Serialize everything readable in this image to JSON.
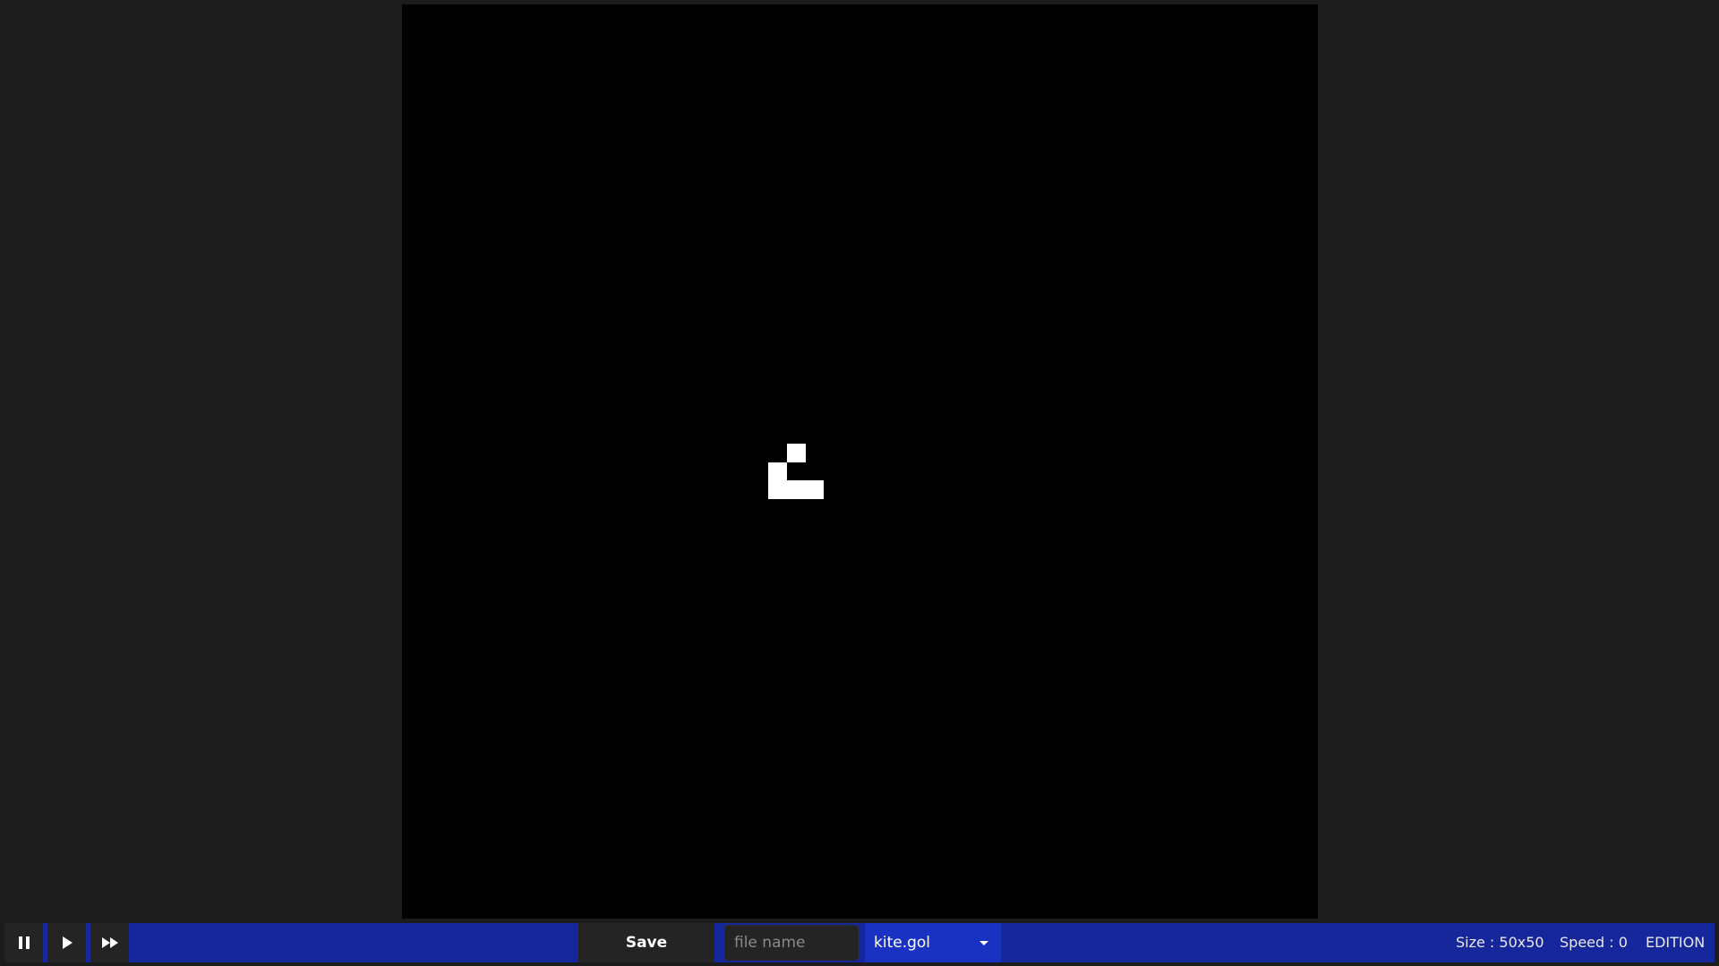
{
  "grid": {
    "size_label": "Size : 50x50",
    "live_cells": [
      {
        "row": 24,
        "col": 21
      },
      {
        "row": 25,
        "col": 20
      },
      {
        "row": 26,
        "col": 20
      },
      {
        "row": 26,
        "col": 21
      },
      {
        "row": 26,
        "col": 22
      }
    ]
  },
  "toolbar": {
    "pause_icon": "pause-icon",
    "play_icon": "play-icon",
    "fast_forward_icon": "fast-forward-icon",
    "save_label": "Save",
    "file_name_placeholder": "file name",
    "file_name_value": "",
    "file_select_value": "kite.gol",
    "speed_label": "Speed : 0",
    "mode_label": "EDITION"
  },
  "colors": {
    "background": "#1c1c1c",
    "canvas": "#000000",
    "live_cell": "#ffffff",
    "toolbar": "#15279a",
    "button": "#242424",
    "select": "#1a32c2"
  }
}
